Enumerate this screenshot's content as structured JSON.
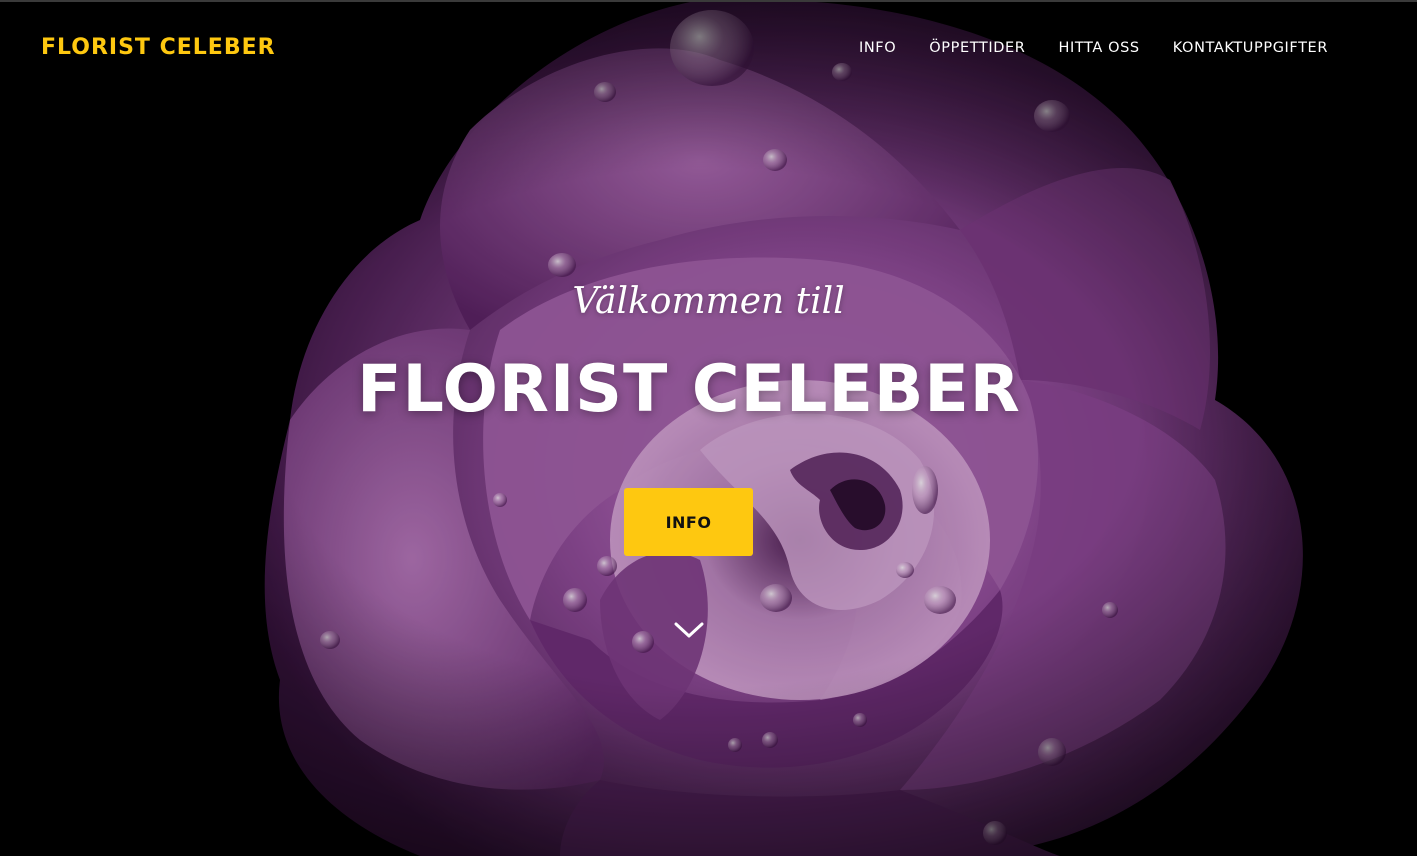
{
  "brand": {
    "name": "FLORIST CELEBER",
    "accent_color": "#fec810"
  },
  "nav": {
    "items": [
      {
        "label": "INFO"
      },
      {
        "label": "ÖPPETTIDER"
      },
      {
        "label": "HITTA OSS"
      },
      {
        "label": "KONTAKTUPPGIFTER"
      }
    ]
  },
  "hero": {
    "background": "purple rose with water droplets on black",
    "subheading": "Välkommen till",
    "heading": "FLORIST CELEBER",
    "button_label": "INFO",
    "scroll_icon": "chevron-down-icon"
  }
}
